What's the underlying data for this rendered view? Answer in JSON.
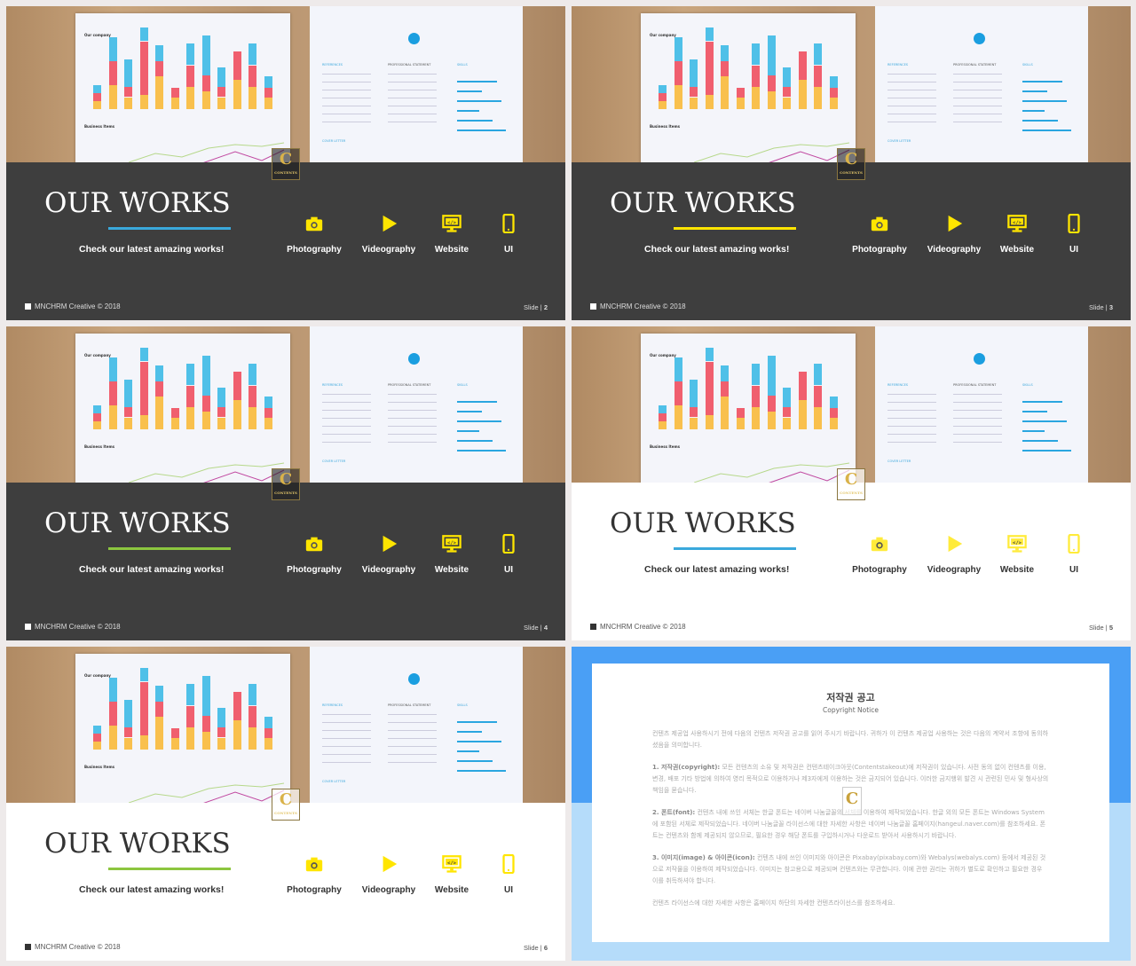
{
  "slides": [
    {
      "number": "2",
      "theme": "dark",
      "underline": "#3aa9dc",
      "icon_color": "#ffe500"
    },
    {
      "number": "3",
      "theme": "dark",
      "underline": "#ffe500",
      "icon_color": "#ffe500"
    },
    {
      "number": "4",
      "theme": "dark",
      "underline": "#8cc63f",
      "icon_color": "#ffe500"
    },
    {
      "number": "5",
      "theme": "light",
      "underline": "#3aa9dc",
      "icon_color": "#ffeb3b"
    },
    {
      "number": "6",
      "theme": "light",
      "underline": "#8cc63f",
      "icon_color": "#ffe500"
    }
  ],
  "common": {
    "title": "OUR WORKS",
    "subtitle": "Check our latest amazing works!",
    "footer": "MNCHRM Creative © 2018",
    "slide_prefix": "Slide | ",
    "logo_text": "CONTENTS",
    "photo": {
      "chart_title": "Our company",
      "chart2_title": "Business Items",
      "references": "REFERENCES",
      "skills": "SKILLS",
      "cover_letter": "COVER LETTER",
      "statement": "PROFESSIONAL STATEMENT"
    },
    "services": [
      {
        "label": "Photography",
        "icon": "camera-icon"
      },
      {
        "label": "Videography",
        "icon": "play-icon"
      },
      {
        "label": "Website",
        "icon": "monitor-code-icon"
      },
      {
        "label": "UI",
        "icon": "smartphone-icon"
      }
    ]
  },
  "notice": {
    "title": "저작권 공고",
    "subtitle": "Copyright Notice",
    "intro": "컨텐츠 제공업 사용하시기 전에 다음의 컨텐츠 저작권 공고를 읽어 주시기 바랍니다. 귀하가 이 컨텐츠 제공업 사용하는 것은 다음의 계약서 조항에 동의하셨음을 의미합니다.",
    "items": [
      {
        "head": "1. 저작권(copyright):",
        "body": "모든 컨텐츠의 소유 및 저작권은 컨텐츠테이크아웃(Contentstakeout)에 저작권이 있습니다. 사전 동의 없이 컨텐츠를 이용, 변경, 배포 기타 방법에 의하여 영리 목적으로 이용하거나 제3자에게 이용하는 것은 금지되어 있습니다. 이러한 금지행위 발견 시 관련된 민사 및 형사상의 책임을 묻습니다."
      },
      {
        "head": "2. 폰트(font):",
        "body": "컨텐츠 내에 쓰인 서체는 한글 폰트는 네이버 나눔글꼴의 서체를 이용하여 제작되었습니다. 한글 외의 모든 폰트는 Windows System에 포함된 서체로 제작되었습니다. 네이버 나눔글꼴 라이선스에 대한 자세한 사항은 네이버 나눔글꼴 홈페이지(hangeul.naver.com)를 참조하세요. 폰트는 컨텐츠와 함께 제공되지 않으므로, 필요한 경우 해당 폰트를 구입하시거나 다운로드 받아서 사용하시기 바랍니다."
      },
      {
        "head": "3. 이미지(image) & 아이콘(icon):",
        "body": "컨텐츠 내에 쓰인 이미지와 아이콘은 Pixabay(pixabay.com)와 Webalys(webalys.com) 등에서 제공된 것으로 저작물을 이용하여 제작되었습니다. 이미지는 참고용으로 제공되며 컨텐츠와는 무관합니다. 이에 관한 권리는 귀하가 별도로 확인하고 필요한 경우 이를 취득하셔야 합니다."
      }
    ],
    "outro": "컨텐츠 라이선스에 대한 자세한 사항은 홈페이지 하단의 자세한 컨텐츠라이선스를 참조하세요."
  }
}
